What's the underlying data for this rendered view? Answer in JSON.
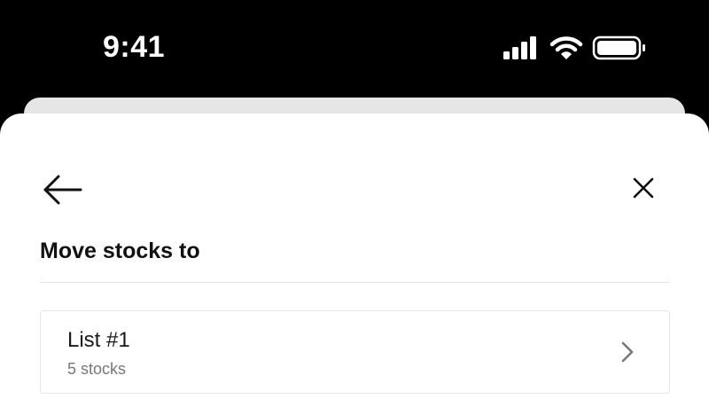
{
  "status_bar": {
    "time": "9:41",
    "icons": [
      "cellular-signal-icon",
      "wifi-icon",
      "battery-icon"
    ]
  },
  "header": {
    "back_icon": "arrow-left-icon",
    "close_icon": "close-icon",
    "title": "Move stocks to"
  },
  "lists": [
    {
      "name": "List #1",
      "count_label": "5 stocks",
      "icon": "chevron-right-icon"
    }
  ],
  "colors": {
    "background": "#000000",
    "sheet": "#ffffff",
    "sheet_behind": "#e6e6e6",
    "title_text": "#111111",
    "secondary_text": "#777777",
    "divider": "#e5e5e5"
  }
}
